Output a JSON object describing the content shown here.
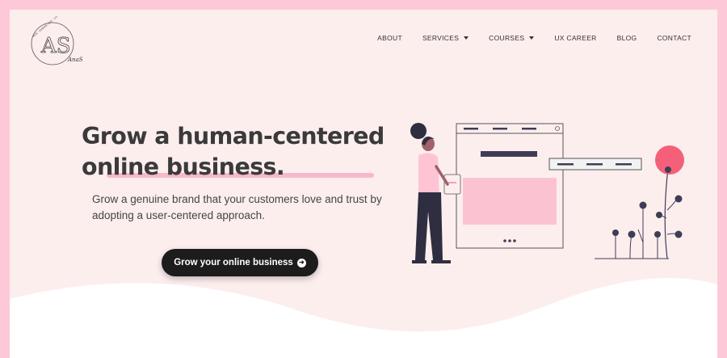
{
  "logo": {
    "initials": "AS",
    "small_text": "ACE · MARKETING · UX",
    "script_text": "AnaSantos"
  },
  "nav": {
    "items": [
      {
        "label": "ABOUT",
        "dropdown": false
      },
      {
        "label": "SERVICES",
        "dropdown": true
      },
      {
        "label": "COURSES",
        "dropdown": true
      },
      {
        "label": "UX CAREER",
        "dropdown": false
      },
      {
        "label": "BLOG",
        "dropdown": false
      },
      {
        "label": "CONTACT",
        "dropdown": false
      }
    ]
  },
  "hero": {
    "headline_line1": "Grow a human-centered",
    "headline_line2": "online business.",
    "subtitle": "Grow a genuine brand that your customers love and trust by adopting a user-centered approach.",
    "cta_label": "Grow your online business"
  },
  "colors": {
    "accent_pink": "#fdc9d8",
    "bg": "#fdeeee",
    "button": "#1c1c1c",
    "flower_red": "#f4607a"
  }
}
